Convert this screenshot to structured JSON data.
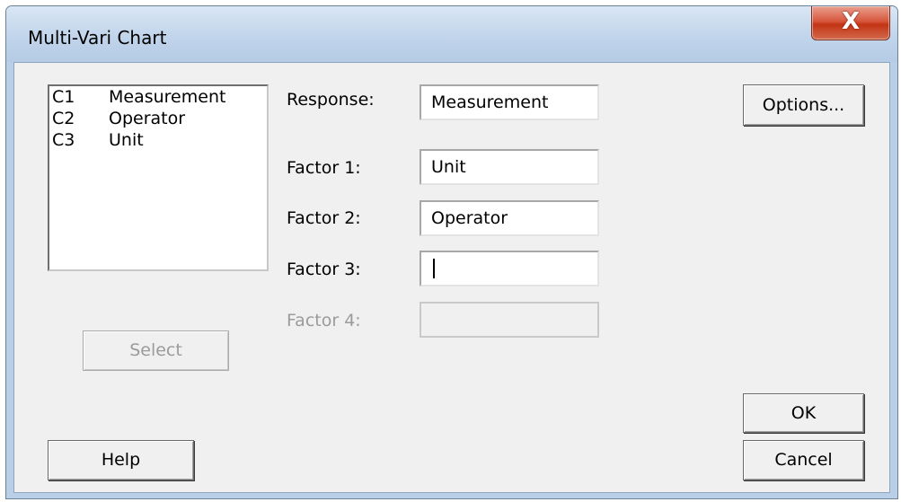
{
  "window": {
    "title": "Multi-Vari Chart",
    "close_glyph": "X"
  },
  "variables": [
    {
      "code": "C1",
      "name": "Measurement"
    },
    {
      "code": "C2",
      "name": "Operator"
    },
    {
      "code": "C3",
      "name": "Unit"
    }
  ],
  "form": {
    "response_label": "Response:",
    "response_value": "Measurement",
    "factor1_label": "Factor 1:",
    "factor1_value": "Unit",
    "factor2_label": "Factor 2:",
    "factor2_value": "Operator",
    "factor3_label": "Factor 3:",
    "factor3_value": "",
    "factor4_label": "Factor 4:",
    "factor4_value": ""
  },
  "buttons": {
    "select": "Select",
    "help": "Help",
    "options": "Options...",
    "ok": "OK",
    "cancel": "Cancel"
  },
  "icons": {
    "close": "close-icon"
  }
}
